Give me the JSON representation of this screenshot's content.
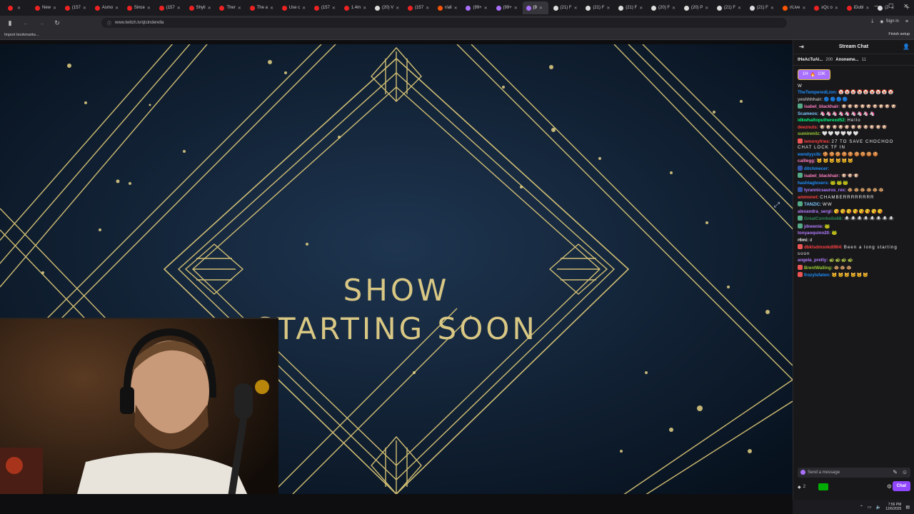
{
  "browser": {
    "tabs": [
      {
        "label": "",
        "color": "#e22"
      },
      {
        "label": "New",
        "color": "#e22"
      },
      {
        "label": "(157",
        "color": "#e22"
      },
      {
        "label": "Asmo",
        "color": "#e22"
      },
      {
        "label": "Since",
        "color": "#e22"
      },
      {
        "label": "(157",
        "color": "#e22"
      },
      {
        "label": "Shyli",
        "color": "#e22"
      },
      {
        "label": "Ther",
        "color": "#e22"
      },
      {
        "label": "The a",
        "color": "#e22"
      },
      {
        "label": "Use c",
        "color": "#e22"
      },
      {
        "label": "(157",
        "color": "#e22"
      },
      {
        "label": "1.4m",
        "color": "#e22"
      },
      {
        "label": "(20) V",
        "color": "#ddd"
      },
      {
        "label": "(157",
        "color": "#e22"
      },
      {
        "label": "r/all",
        "color": "#f50"
      },
      {
        "label": "(99+",
        "color": "#a970ff"
      },
      {
        "label": "(99+",
        "color": "#a970ff"
      },
      {
        "label": "(9",
        "color": "#a970ff",
        "active": true
      },
      {
        "label": "(21) F",
        "color": "#ddd"
      },
      {
        "label": "(21) F",
        "color": "#ddd"
      },
      {
        "label": "(21) F",
        "color": "#ddd"
      },
      {
        "label": "(20) F",
        "color": "#ddd"
      },
      {
        "label": "(20) P",
        "color": "#ddd"
      },
      {
        "label": "(21) F",
        "color": "#ddd"
      },
      {
        "label": "(21) F",
        "color": "#ddd"
      },
      {
        "label": "r/Live",
        "color": "#f50"
      },
      {
        "label": "xQc o",
        "color": "#e22"
      },
      {
        "label": "iDubl",
        "color": "#e22"
      },
      {
        "label": "(2",
        "color": "#ddd"
      }
    ],
    "url": "www.twitch.tv/qtcinderella",
    "sign_in": "Sign in",
    "bookmark_import": "Import bookmarks...",
    "finish_setup": "Finish setup"
  },
  "stream": {
    "title_line1": "SHOW",
    "title_line2": "STARTING SOON"
  },
  "chat": {
    "header": "Stream Chat",
    "leaderboard": [
      {
        "user": "tHeAcTuAl...",
        "value": "200"
      },
      {
        "user": "Anoneme...",
        "value": "11"
      }
    ],
    "sub_badge": "10K",
    "sub_months": "1H",
    "messages": [
      {
        "user": "",
        "text": "W",
        "color": "#efeff1",
        "badge": ""
      },
      {
        "user": "TheTemperedLion:",
        "text": "🤡🤡🤡🤡🤡🤡🤡🤡🤡",
        "color": "#1e90ff",
        "badge": ""
      },
      {
        "user": "yeshhhhair:",
        "text": "🔵🔵🔵🔵",
        "color": "#b0b0b0",
        "badge": ""
      },
      {
        "user": "isabel_blackhair:",
        "text": "🐶🐶🐶🐶🐶🐶🐶🐶🐶",
        "color": "#ff7fbf",
        "badge": "#5a8"
      },
      {
        "user": "Scameos:",
        "text": "🦄🦄🦄🦄🦄🦄🦄🦄🦄",
        "color": "#7ec8ff",
        "badge": ""
      },
      {
        "user": "idkwhattoputherexd52:",
        "text": "Hello",
        "color": "#00ff7f",
        "badge": ""
      },
      {
        "user": "deeznuts:",
        "text": "🐶🐶🐶🐶🐶🐶🐶🐶🐶🐶🐶",
        "color": "#ff4040",
        "badge": ""
      },
      {
        "user": "suminmilz:",
        "text": "🤍🤍🤍🤍🤍🤍",
        "color": "#9acd32",
        "badge": ""
      },
      {
        "user": "lemonyfries:",
        "text": "27 TO SAVE CHOCHOO CHAT LOCK TF IN",
        "color": "#ff4040",
        "badge": "#e55"
      },
      {
        "user": "wendyyclb:",
        "text": "🍪🍪🍪🍪🍪🍪🍪🍪🍪",
        "color": "#1e90ff",
        "badge": ""
      },
      {
        "user": "calllegg:",
        "text": "🐱🐱🐱🐱🐱🐱",
        "color": "#ff7fbf",
        "badge": ""
      },
      {
        "user": "ditchmecer:",
        "text": "",
        "color": "#1e90ff",
        "badge": "#35a"
      },
      {
        "user": "isabel_blackhair:",
        "text": "🐶🐶🐶",
        "color": "#ff7fbf",
        "badge": "#5a8"
      },
      {
        "user": "hashtaglosers:",
        "text": "🐸🐸🐸",
        "color": "#1e90ff",
        "badge": ""
      },
      {
        "user": "tyrannicsaurus_rex:",
        "text": "🐵🐵🐵🐵🐵🐵",
        "color": "#b47eff",
        "badge": "#35a"
      },
      {
        "user": "ammonet:",
        "text": "CHAMBERRRRRRRR",
        "color": "#ff4040",
        "badge": ""
      },
      {
        "user": "TANZIC:",
        "text": "WW",
        "color": "#7ec8ff",
        "badge": "#5a8"
      },
      {
        "user": "alexandra_sergi:",
        "text": "😘😘😘😘😘😘😘😘",
        "color": "#b47eff",
        "badge": ""
      },
      {
        "user": "GreatCornholio68:",
        "text": "🕷🕷🕷🕷🕷🕷🕷🕷",
        "color": "#2e8b57",
        "badge": "#5a8"
      },
      {
        "user": "jdneenie:",
        "text": "🐸",
        "color": "#b47eff",
        "badge": "#5a8"
      },
      {
        "user": "tonyaoquinn20:",
        "text": "🐸",
        "color": "#b47eff",
        "badge": ""
      },
      {
        "user": "r6mi:",
        "text": "d",
        "color": "#efeff1",
        "badge": ""
      },
      {
        "user": "dbklsdmsnkdl904:",
        "text": "Been a long starting soon",
        "color": "#ff4040",
        "badge": "#e55"
      },
      {
        "user": "angela_pretty:",
        "text": "🐢🐢🐢🐢",
        "color": "#b47eff",
        "badge": ""
      },
      {
        "user": "BrentWalling:",
        "text": "🐵🐵🐵",
        "color": "#9acd32",
        "badge": "#e55"
      },
      {
        "user": "frozylsfaton:",
        "text": "🐱🐱🐱🐱🐱🐱",
        "color": "#1e90ff",
        "badge": "#e55"
      }
    ],
    "input_placeholder": "Send a message",
    "points": "2",
    "send_label": "Chat"
  },
  "taskbar": {
    "time": "7:56 PM",
    "date": "12/6/2025"
  }
}
